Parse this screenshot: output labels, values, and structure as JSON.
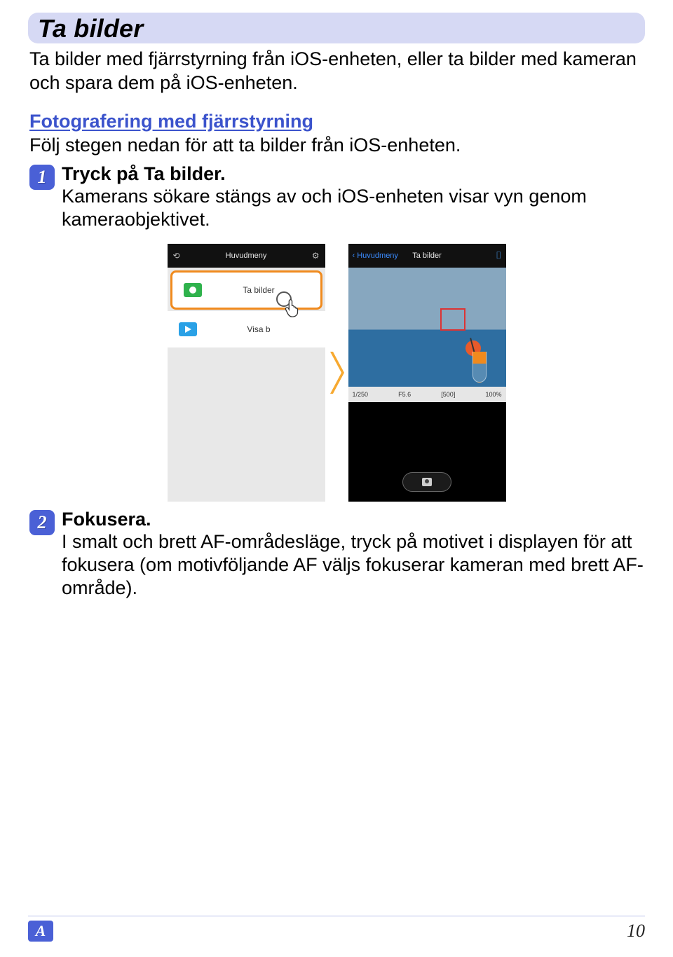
{
  "section": {
    "title": "Ta bilder",
    "intro": "Ta bilder med fjärrstyrning från iOS-enheten, eller ta bilder med kameran och spara dem på iOS-enheten."
  },
  "subsection": {
    "title": "Fotografering med fjärrstyrning",
    "desc": "Följ stegen nedan för att ta bilder från iOS-enheten."
  },
  "steps": [
    {
      "num": "1",
      "title": "Tryck på Ta bilder.",
      "text": "Kamerans sökare stängs av och iOS-enheten visar vyn genom kameraobjektivet."
    },
    {
      "num": "2",
      "title": "Fokusera.",
      "text": "I smalt och brett AF-områdesläge, tryck på motivet i displayen för att fokusera (om motivföljande AF väljs fokuserar kameran med brett AF-område)."
    }
  ],
  "phone_left": {
    "header": "Huvudmeny",
    "row1_label": "Ta bilder",
    "row2_label": "Visa b"
  },
  "phone_right": {
    "back": "Huvudmeny",
    "title": "Ta bilder",
    "readout": {
      "shutter": "1/250",
      "aperture": "F5.6",
      "iso": "[500]",
      "battery": "100%"
    }
  },
  "footer": {
    "section_letter": "A",
    "page": "10"
  }
}
